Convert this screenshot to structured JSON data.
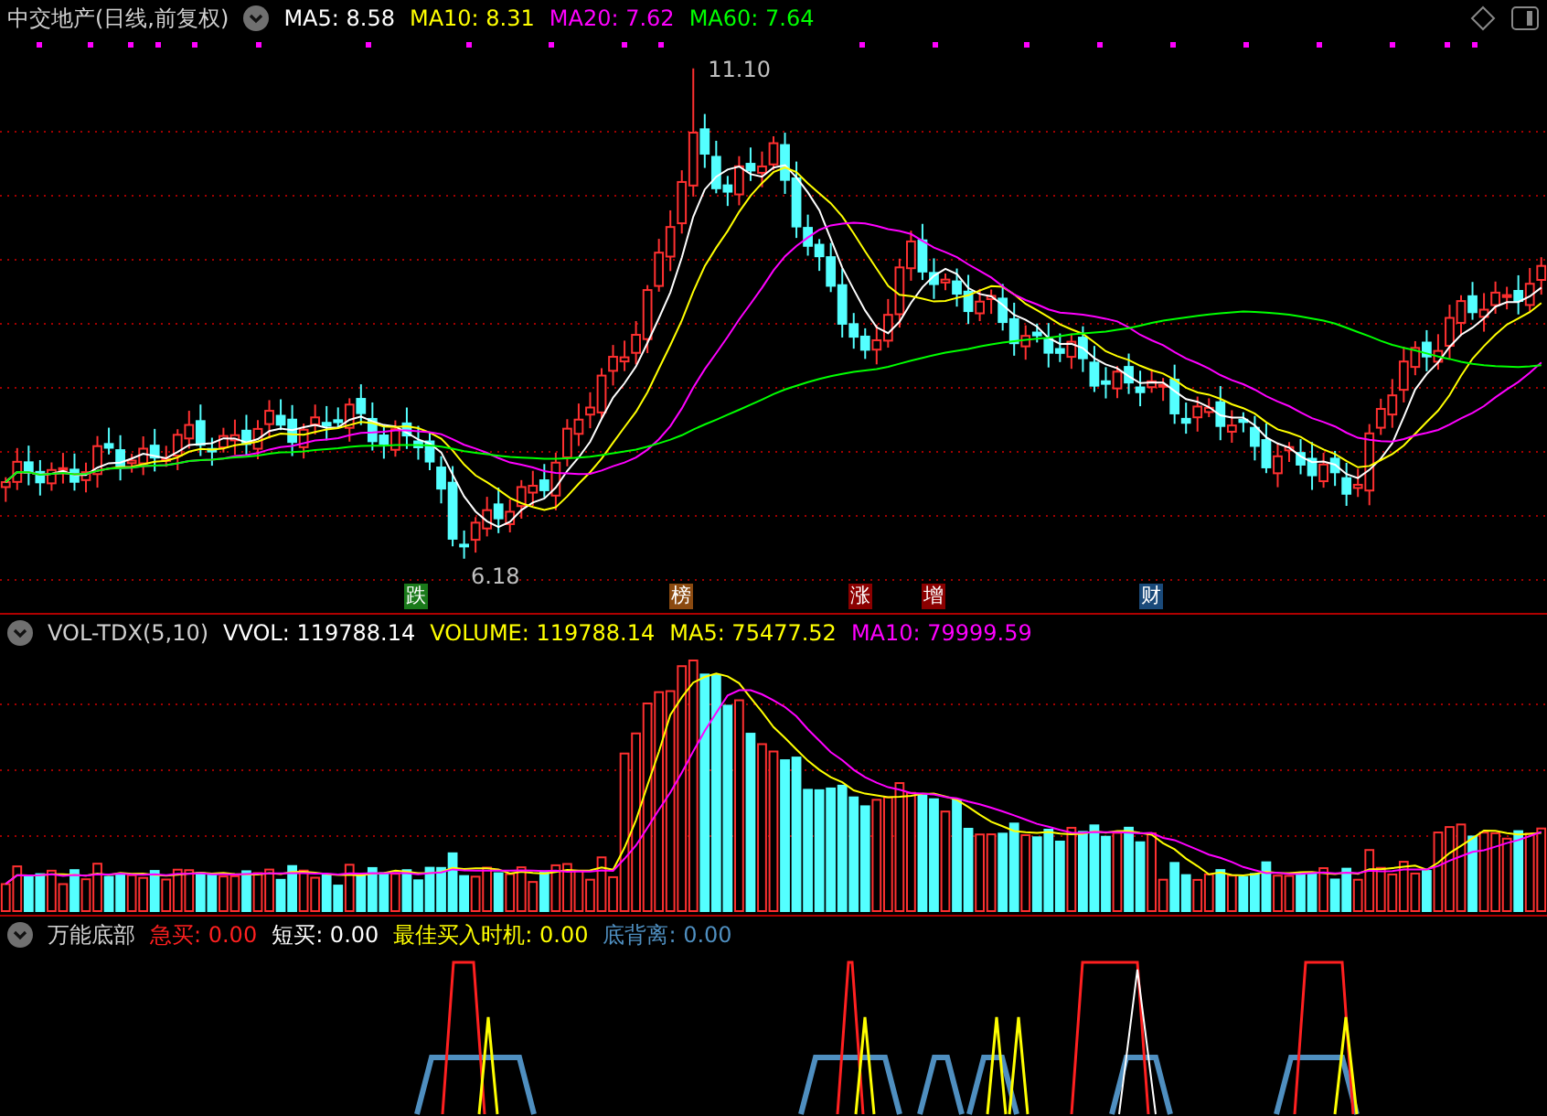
{
  "main_panel": {
    "title": "中交地产(日线,前复权)",
    "indicators": [
      {
        "label": "MA5: 8.58",
        "color": "#ffffff"
      },
      {
        "label": "MA10: 8.31",
        "color": "#ffff00"
      },
      {
        "label": "MA20: 7.62",
        "color": "#ff00ff"
      },
      {
        "label": "MA60: 7.64",
        "color": "#00ff00"
      }
    ],
    "high_label": "11.10",
    "low_label": "6.18",
    "event_tags": [
      {
        "label": "跌",
        "color": "#1a7a1a"
      },
      {
        "label": "榜",
        "color": "#8b4a10"
      },
      {
        "label": "涨",
        "color": "#8b0000"
      },
      {
        "label": "增",
        "color": "#8b0000"
      },
      {
        "label": "财",
        "color": "#1a4a7a"
      }
    ]
  },
  "volume_panel": {
    "title": "VOL-TDX(5,10)",
    "indicators": [
      {
        "label": "VVOL: 119788.14",
        "color": "#ffffff"
      },
      {
        "label": "VOLUME: 119788.14",
        "color": "#ffff00"
      },
      {
        "label": "MA5: 75477.52",
        "color": "#ffff00"
      },
      {
        "label": "MA10: 79999.59",
        "color": "#ff00ff"
      }
    ]
  },
  "indicator_panel": {
    "title": "万能底部",
    "indicators": [
      {
        "label": "急买: 0.00",
        "color": "#ff2020"
      },
      {
        "label": "短买: 0.00",
        "color": "#ffffff"
      },
      {
        "label": "最佳买入时机: 0.00",
        "color": "#ffff00"
      },
      {
        "label": "底背离: 0.00",
        "color": "#4f8fc0"
      }
    ]
  }
}
